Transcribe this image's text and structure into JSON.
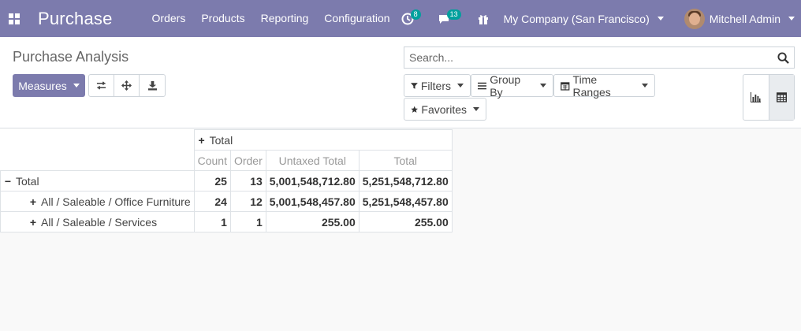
{
  "navbar": {
    "brand": "Purchase",
    "menu": [
      "Orders",
      "Products",
      "Reporting",
      "Configuration"
    ],
    "activity_count": "8",
    "messages_count": "13",
    "company": "My Company (San Francisco)",
    "user": "Mitchell Admin",
    "bg_color": "#7c7bad"
  },
  "control": {
    "title": "Purchase Analysis",
    "measures_label": "Measures",
    "search_placeholder": "Search...",
    "filters_label": "Filters",
    "groupby_label": "Group By",
    "timeranges_label": "Time Ranges",
    "favorites_label": "Favorites",
    "icons": [
      "flip-axis-icon",
      "expand-all-icon",
      "download-icon",
      "bar-chart-icon",
      "table-icon"
    ]
  },
  "pivot": {
    "col_header": "Total",
    "measures": [
      "Count",
      "Order",
      "Untaxed Total",
      "Total"
    ],
    "rows": [
      {
        "label": "Total",
        "values": [
          "25",
          "13",
          "5,001,548,712.80",
          "5,251,548,712.80"
        ]
      },
      {
        "label": "All / Saleable / Office Furniture",
        "values": [
          "24",
          "12",
          "5,001,548,457.80",
          "5,251,548,457.80"
        ]
      },
      {
        "label": "All / Saleable / Services",
        "values": [
          "1",
          "1",
          "255.00",
          "255.00"
        ]
      }
    ]
  }
}
